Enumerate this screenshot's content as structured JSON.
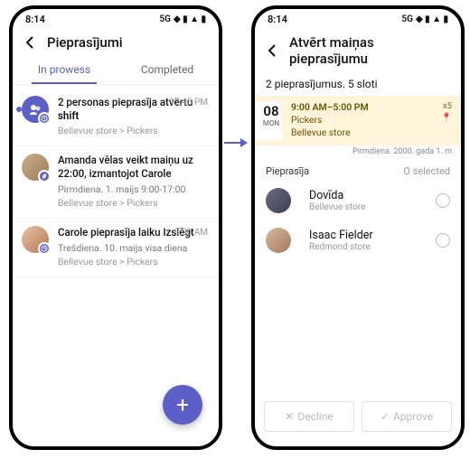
{
  "status": {
    "time": "8:14",
    "network": "5G"
  },
  "phone1": {
    "title": "Pieprasījumi",
    "tabs": {
      "active": "In prowess",
      "inactive": "Completed"
    },
    "items": [
      {
        "title_pre": "2 personas pieprasīja atvērtu ",
        "title_bold": "shift",
        "sub": "",
        "crumb": "Bellevue store > Pickers",
        "time": "12:45 PM"
      },
      {
        "title": "Amanda vēlas veikt maiņu uz 22:00, izmantojot Carole",
        "sub": "Pirmdiena. 1. maijs 9:00-17:00",
        "crumb": "Bellevue store > Pickers",
        "time": ""
      },
      {
        "title": "Carole pieprasīja laiku Izslēgt",
        "sub": "Trešdiena. 10. maijs visa diena",
        "crumb": "Bellevue store > Pickers",
        "time": "9:00 AM"
      }
    ]
  },
  "phone2": {
    "title": "Atvērt maiņas pieprasījumu",
    "summary": "2 pieprasījumus. 5 sloti",
    "shift": {
      "day": "08",
      "dow": "MON",
      "time": "9:00 AM–5:00 PM",
      "role": "Pickers",
      "store": "Bellevue store",
      "count": "x5",
      "footnote": "Pirmdiena. 2000. gada 1. m"
    },
    "req_label": "Pieprasīja",
    "selected_label": "O selected",
    "people": [
      {
        "name": "Dovīda",
        "store": "Bellevue store"
      },
      {
        "name": "Isaac Fielder",
        "store": "Redmond store"
      }
    ],
    "actions": {
      "decline": "Decline",
      "approve": "Approve"
    },
    "icons": {
      "pin": "📍"
    }
  }
}
